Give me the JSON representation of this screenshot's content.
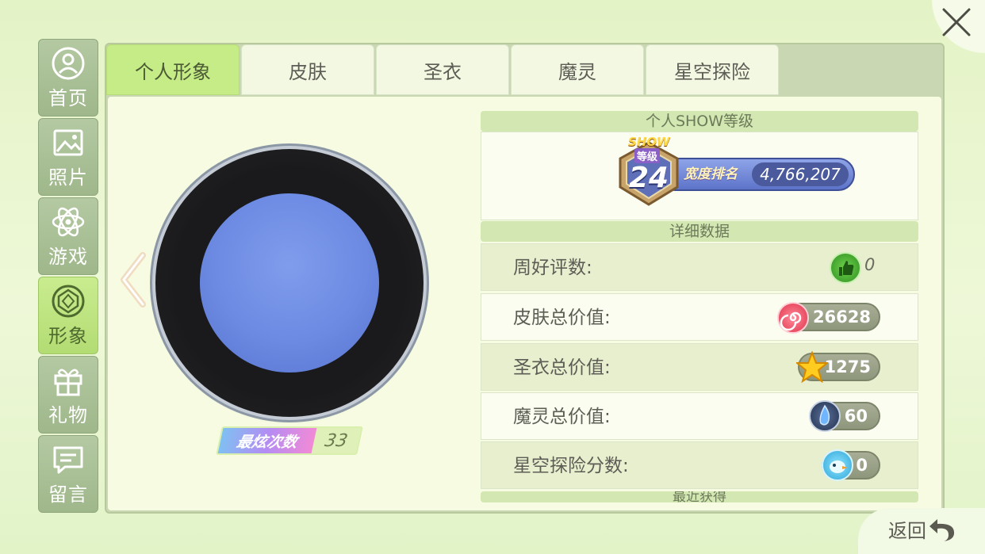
{
  "sidebar": {
    "items": [
      {
        "label": "首页",
        "icon": "home-icon"
      },
      {
        "label": "照片",
        "icon": "photo-icon"
      },
      {
        "label": "游戏",
        "icon": "atom-icon"
      },
      {
        "label": "形象",
        "icon": "gem-icon"
      },
      {
        "label": "礼物",
        "icon": "gift-icon"
      },
      {
        "label": "留言",
        "icon": "message-icon"
      }
    ]
  },
  "tabs": [
    "个人形象",
    "皮肤",
    "圣衣",
    "魔灵",
    "星空探险"
  ],
  "avatar": {
    "dazzle_label": "最炫次数",
    "dazzle_value": "33"
  },
  "show_level": {
    "section_title": "个人SHOW等级",
    "badge_text": "SHOW",
    "badge_sub": "等级",
    "level": "24",
    "rank_label": "宽度排名",
    "rank_value": "4,766,207"
  },
  "details": {
    "section_title": "详细数据",
    "rows": [
      {
        "label": "周好评数:",
        "value": "0",
        "icon": "thumbs-up-icon"
      },
      {
        "label": "皮肤总价值:",
        "value": "26628",
        "icon": "swirl-candy-icon"
      },
      {
        "label": "圣衣总价值:",
        "value": "1275",
        "icon": "star-icon"
      },
      {
        "label": "魔灵总价值:",
        "value": "60",
        "icon": "spirit-crystal-icon"
      },
      {
        "label": "星空探险分数:",
        "value": "0",
        "icon": "bird-icon"
      }
    ],
    "next_section_title": "最近获得"
  },
  "footer": {
    "return_label": "返回"
  },
  "colors": {
    "active_green": "#c5ec86",
    "sidebar_green": "#9fb78b",
    "avatar_blue": "#6c8ae2"
  }
}
